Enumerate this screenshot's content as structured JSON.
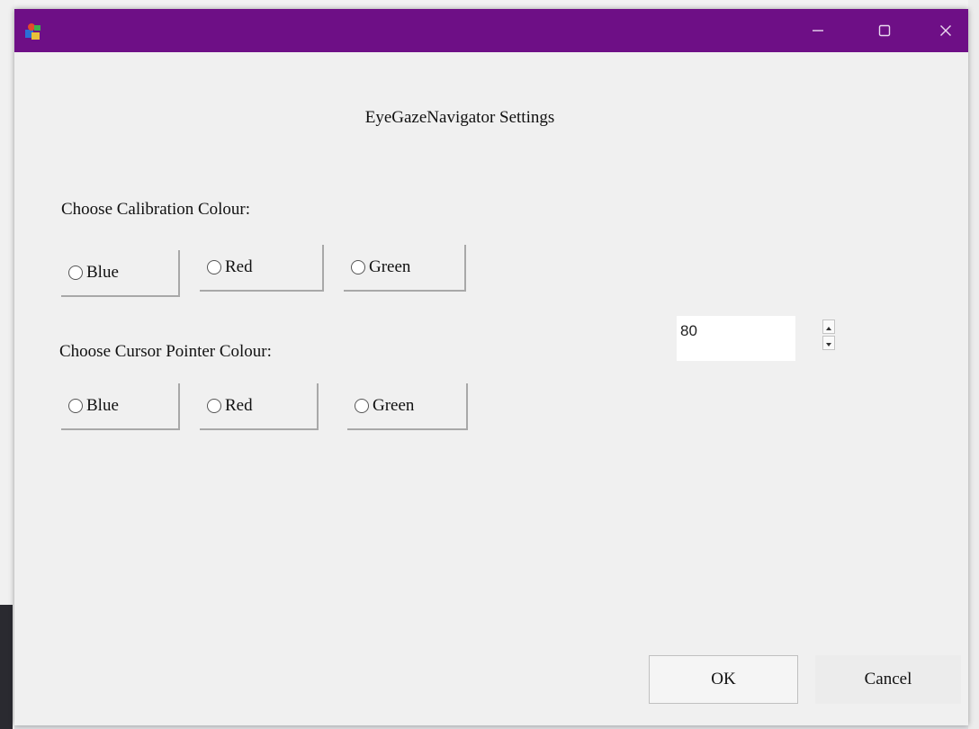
{
  "window": {
    "heading": "EyeGazeNavigator Settings",
    "accent_color": "#6e0f86"
  },
  "calibration": {
    "label": "Choose Calibration Colour:",
    "options": [
      "Blue",
      "Red",
      "Green"
    ]
  },
  "cursor": {
    "label": "Choose Cursor Pointer Colour:",
    "options": [
      "Blue",
      "Red",
      "Green"
    ]
  },
  "spinner": {
    "value": "80"
  },
  "buttons": {
    "ok": "OK",
    "cancel": "Cancel"
  },
  "icons": {
    "app": "app-icon",
    "minimize": "minimize-icon",
    "maximize": "maximize-icon",
    "close": "close-icon",
    "spin_up": "spin-up-arrow-icon",
    "spin_down": "spin-down-arrow-icon"
  }
}
